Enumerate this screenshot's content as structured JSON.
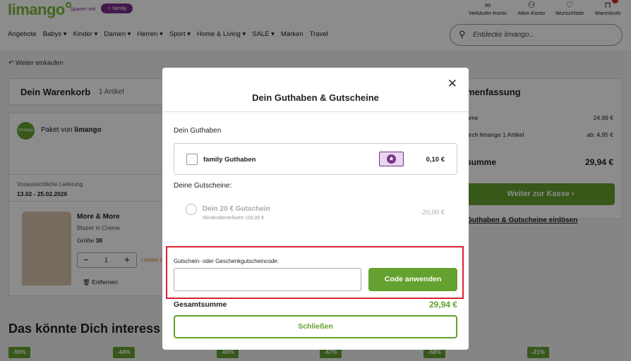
{
  "header": {
    "logo": "limango",
    "sparen_text": "Sparen mit",
    "family_badge": "family",
    "icons": [
      {
        "name": "verkaeufer-konto",
        "label": "Verkäufer-Konto",
        "glyph": "∞"
      },
      {
        "name": "mein-konto",
        "label": "Mein Konto",
        "glyph": "☺"
      },
      {
        "name": "wunschliste",
        "label": "Wunschliste",
        "glyph": "♡"
      },
      {
        "name": "warenkorb",
        "label": "Warenkorb",
        "glyph": "🛍"
      }
    ],
    "nav": [
      "Angebote",
      "Babys ▾",
      "Kinder ▾",
      "Damen ▾",
      "Herren ▾",
      "Sport ▾",
      "Home & Living ▾",
      "SALE ▾",
      "Marken",
      "Travel"
    ],
    "search_placeholder": "Entdecke limango..."
  },
  "page": {
    "back_link": "Weiter einkaufen",
    "cart_title": "Dein Warenkorb",
    "cart_count": "1 Artikel",
    "paket_logo": "limango",
    "paket_prefix": "Paket von",
    "paket_seller": "limango",
    "delivery_label": "Voraussichtliche Lieferung",
    "delivery_dates": "13.02 - 25.02.2026",
    "product_brand": "More & More",
    "product_name": "Blazer in Creme",
    "size_label": "Größe",
    "size_value": "38",
    "qty": "1",
    "last_stock": "Letztes S",
    "remove_label": "Entfernen",
    "summary_title": "Zusammenfassung",
    "summary_title_visible": "menfassung",
    "summary_rows": [
      {
        "label": "nme",
        "value": "24,99 €"
      },
      {
        "label": "urch limango 1 Artikel",
        "value": "ab: 4,95 €"
      }
    ],
    "summary_total_label": "summe",
    "summary_total_value": "29,94 €",
    "checkout_button": "Weiter zur Kasse ›",
    "redeem_link": "Guthaben & Gutscheine einlösen",
    "recommend_title": "Das könnte Dich interess",
    "discounts": [
      "-55%",
      "-44%",
      "-60%",
      "-67%",
      "-58%",
      "-21%"
    ]
  },
  "modal": {
    "title": "Dein Guthaben & Gutscheine",
    "guthaben_section": "Dein Guthaben",
    "family_guthaben_label": "family Guthaben",
    "family_guthaben_amount": "0,10 €",
    "coupons_section": "Deine Gutscheine:",
    "coupon_name": "Dein 20 € Gutschein",
    "coupon_min": "Mindestbestellwert 100,00 €",
    "coupon_amount": "-20,00 €",
    "code_label": "Gutschein- oder Geschenkgutscheincode:",
    "code_value": "",
    "apply_button": "Code anwenden",
    "total_label": "Gesamtsumme",
    "total_value": "29,94 €",
    "close_button": "Schließen",
    "close_glyph": "✕"
  },
  "colors": {
    "brand_green": "#65a12e",
    "family_purple": "#7a2f8a",
    "highlight_red": "#d9232f"
  }
}
